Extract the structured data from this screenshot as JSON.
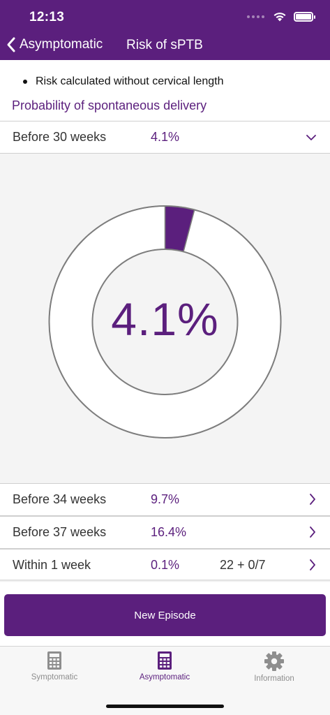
{
  "status_bar": {
    "time": "12:13"
  },
  "nav": {
    "back_label": "Asymptomatic",
    "title": "Risk of sPTB"
  },
  "note": "Risk calculated without cervical length",
  "section_title": "Probability of spontaneous delivery",
  "selected_row": {
    "label": "Before 30 weeks",
    "value": "4.1%"
  },
  "chart_data": {
    "type": "pie",
    "style": "donut",
    "values": [
      4.1,
      95.9
    ],
    "center_label": "4.1%",
    "colors": [
      "#5b1f7d",
      "#ffffff"
    ]
  },
  "rows": [
    {
      "label": "Before 34 weeks",
      "value": "9.7%",
      "extra": ""
    },
    {
      "label": "Before 37 weeks",
      "value": "16.4%",
      "extra": ""
    },
    {
      "label": "Within 1 week",
      "value": "0.1%",
      "extra": "22 + 0/7"
    }
  ],
  "primary_button": {
    "label": "New Episode"
  },
  "tabs": [
    {
      "label": "Symptomatic",
      "icon": "calculator-icon",
      "active": false
    },
    {
      "label": "Asymptomatic",
      "icon": "calculator-icon",
      "active": true
    },
    {
      "label": "Information",
      "icon": "gear-icon",
      "active": false
    }
  ],
  "colors": {
    "brand": "#5b1f7d",
    "background": "#f4f4f4",
    "inactive_tab": "#8e8e8e"
  }
}
